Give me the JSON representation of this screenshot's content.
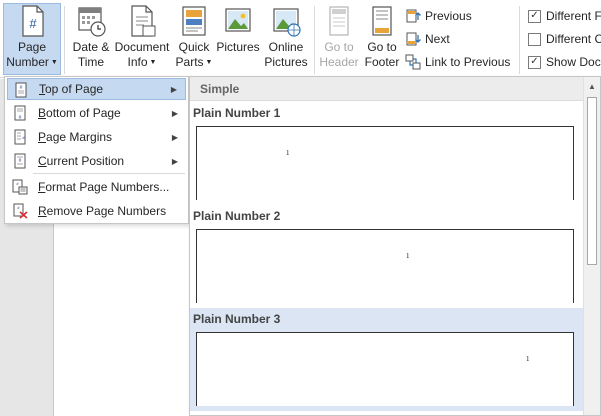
{
  "ribbon": {
    "page_number": {
      "line1": "Page",
      "line2": "Number"
    },
    "date_time": {
      "line1": "Date &",
      "line2": "Time"
    },
    "document_info": {
      "line1": "Document",
      "line2": "Info"
    },
    "quick_parts": {
      "line1": "Quick",
      "line2": "Parts"
    },
    "pictures": {
      "line1": "Pictures",
      "line2": ""
    },
    "online_pictures": {
      "line1": "Online",
      "line2": "Pictures"
    },
    "go_to_header": {
      "line1": "Go to",
      "line2": "Header"
    },
    "go_to_footer": {
      "line1": "Go to",
      "line2": "Footer"
    },
    "previous": "Previous",
    "next": "Next",
    "link_to_previous": "Link to Previous",
    "options": [
      "Different F",
      "Different C",
      "Show Docu"
    ],
    "options_checked": [
      true,
      false,
      true
    ]
  },
  "menu": {
    "items": [
      {
        "label": "Top of Page",
        "has_submenu": true
      },
      {
        "label": "Bottom of Page",
        "has_submenu": true
      },
      {
        "label": "Page Margins",
        "has_submenu": true
      },
      {
        "label": "Current Position",
        "has_submenu": true
      },
      {
        "label": "Format Page Numbers...",
        "has_submenu": false
      },
      {
        "label": "Remove Page Numbers",
        "has_submenu": false
      }
    ]
  },
  "gallery": {
    "section": "Simple",
    "items": [
      {
        "title": "Plain Number 1",
        "number": "1",
        "align": "left"
      },
      {
        "title": "Plain Number 2",
        "number": "1",
        "align": "center"
      },
      {
        "title": "Plain Number 3",
        "number": "1",
        "align": "right"
      }
    ]
  },
  "colors": {
    "selection_fill": "#c5d9f1",
    "selection_border": "#9dbbe0",
    "gallery_highlight": "#dbe5f3"
  }
}
